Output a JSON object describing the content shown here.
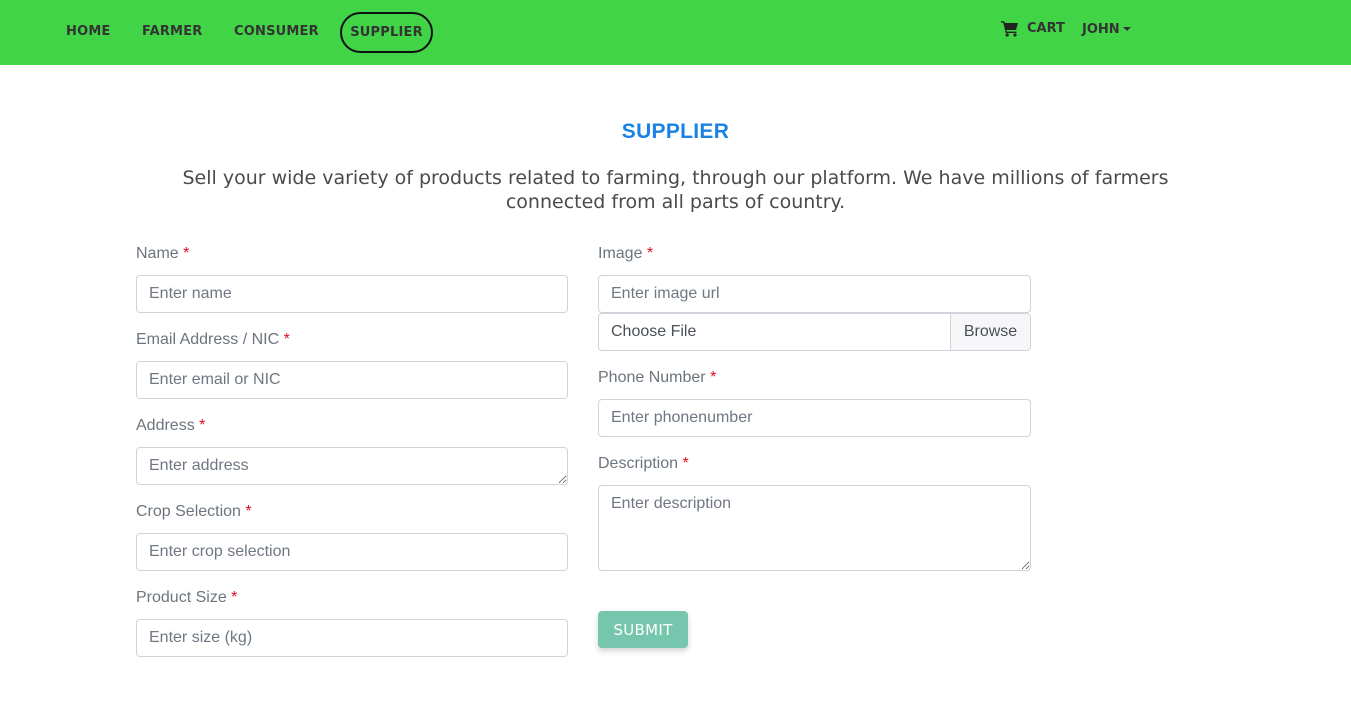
{
  "nav": {
    "home": "HOME",
    "farmer": "FARMER",
    "consumer": "CONSUMER",
    "supplier": "SUPPLIER",
    "cart": "CART",
    "user": "JOHN",
    "bar_color": "#41d446"
  },
  "page": {
    "title": "SUPPLIER",
    "description": "Sell your wide variety of products related to farming, through our platform. We have millions of farmers connected from all parts of country.",
    "accent": "#1a82e2"
  },
  "form": {
    "required_mark": "*",
    "name": {
      "label": "Name",
      "placeholder": "Enter name",
      "value": ""
    },
    "email": {
      "label": "Email Address / NIC",
      "placeholder": "Enter email or NIC",
      "value": ""
    },
    "address": {
      "label": "Address",
      "placeholder": "Enter address",
      "value": ""
    },
    "crop": {
      "label": "Crop Selection",
      "placeholder": "Enter crop selection",
      "value": ""
    },
    "size": {
      "label": "Product Size",
      "placeholder": "Enter size (kg)",
      "value": ""
    },
    "image": {
      "label": "Image",
      "placeholder": "Enter image url",
      "value": ""
    },
    "file": {
      "text": "Choose File",
      "browse": "Browse"
    },
    "phone": {
      "label": "Phone Number",
      "placeholder": "Enter phonenumber",
      "value": ""
    },
    "description": {
      "label": "Description",
      "placeholder": "Enter description",
      "value": ""
    },
    "submit": "SUBMIT",
    "submit_color": "#76c6ad"
  },
  "icons": {
    "cart": "shopping-cart-icon",
    "user_menu": "caret-down-icon"
  }
}
